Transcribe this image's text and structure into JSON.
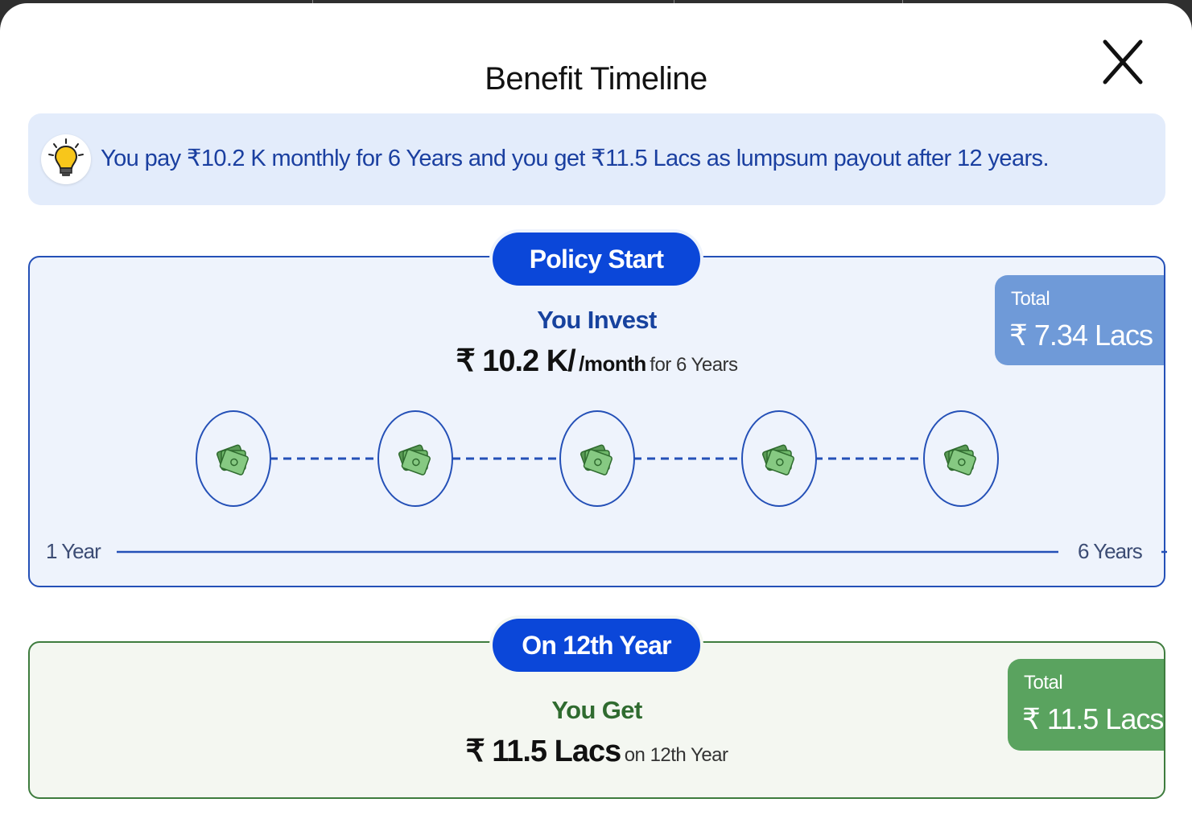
{
  "modal": {
    "title": "Benefit Timeline",
    "close_icon": "close-icon"
  },
  "tip": {
    "icon": "lightbulb-icon",
    "text": "You pay ₹10.2 K monthly for 6 Years and you get ₹11.5 Lacs as lumpsum payout after 12 years."
  },
  "invest_card": {
    "pill_label": "Policy Start",
    "heading": "You Invest",
    "amount": "₹ 10.2 K/",
    "per": "/month",
    "duration": "for 6 Years",
    "total_label": "Total",
    "total_value": "₹ 7.34 Lacs",
    "timeline_icon": "money-stack-icon",
    "timeline_count": 5,
    "start_label": "1 Year",
    "end_label": "6 Years"
  },
  "get_card": {
    "pill_label": "On 12th Year",
    "heading": "You Get",
    "amount": "₹ 11.5 Lacs",
    "suffix": "on 12th Year",
    "total_label": "Total",
    "total_value": "₹ 11.5 Lacs"
  },
  "colors": {
    "invest_accent": "#2450b7",
    "pill_blue": "#0b47d9",
    "get_accent": "#3e7c3e",
    "invest_badge": "#6f9ad8",
    "get_badge": "#5aa35f",
    "tip_bg": "#e3ecfb"
  }
}
